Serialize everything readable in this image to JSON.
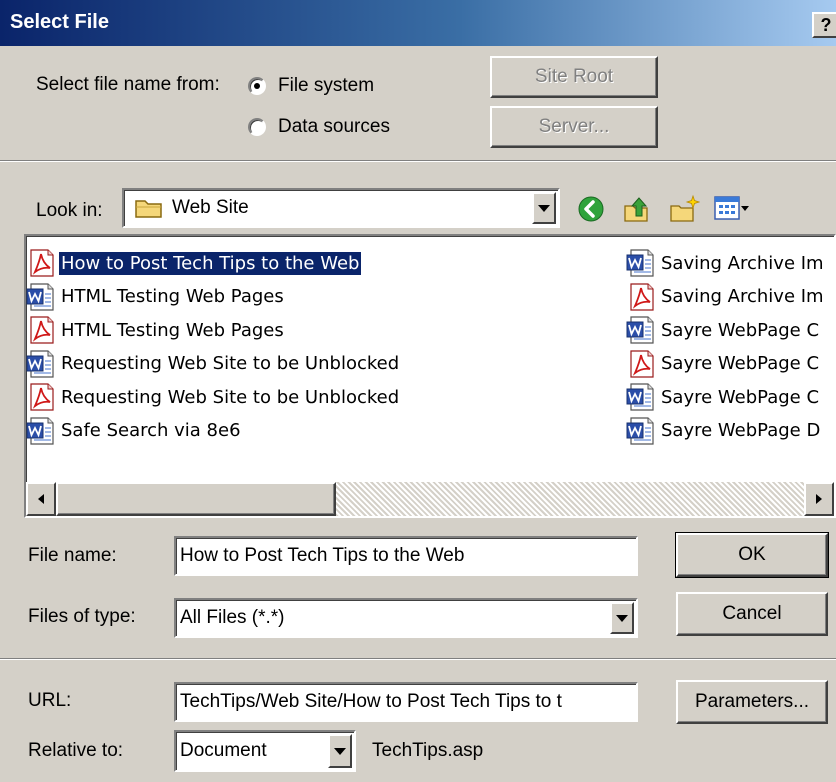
{
  "window": {
    "title": "Select File",
    "help_label": "?"
  },
  "source": {
    "label": "Select file name from:",
    "options": [
      {
        "label": "File system",
        "checked": true
      },
      {
        "label": "Data sources",
        "checked": false
      }
    ],
    "site_root_label": "Site Root",
    "server_label": "Server..."
  },
  "lookin": {
    "label": "Look in:",
    "value": "Web Site",
    "toolbar": [
      "back-icon",
      "up-folder-icon",
      "new-folder-icon",
      "view-menu-icon"
    ]
  },
  "files": [
    {
      "name": "How to Post Tech Tips to the Web",
      "type": "pdf",
      "selected": true
    },
    {
      "name": "HTML Testing Web Pages",
      "type": "word"
    },
    {
      "name": "HTML Testing Web Pages",
      "type": "pdf"
    },
    {
      "name": "Requesting Web Site to be Unblocked",
      "type": "word"
    },
    {
      "name": "Requesting Web Site to be Unblocked",
      "type": "pdf"
    },
    {
      "name": "Safe Search via 8e6",
      "type": "word"
    },
    {
      "name": "Saving Archive Im",
      "type": "word"
    },
    {
      "name": "Saving Archive Im",
      "type": "pdf"
    },
    {
      "name": "Sayre WebPage C",
      "type": "word"
    },
    {
      "name": "Sayre WebPage C",
      "type": "pdf"
    },
    {
      "name": "Sayre WebPage C",
      "type": "word"
    },
    {
      "name": "Sayre WebPage D",
      "type": "word"
    }
  ],
  "filename": {
    "label": "File name:",
    "value": "How to Post Tech Tips to the Web"
  },
  "filetype": {
    "label": "Files of type:",
    "value": "All Files (*.*)"
  },
  "buttons": {
    "ok": "OK",
    "cancel": "Cancel",
    "parameters": "Parameters..."
  },
  "url": {
    "label": "URL:",
    "value": "TechTips/Web Site/How to Post Tech Tips to t"
  },
  "relative": {
    "label": "Relative to:",
    "value": "Document",
    "page": "TechTips.asp"
  },
  "colors": {
    "title_start": "#0a246a",
    "title_end": "#a6caf0",
    "face": "#d4d0c8",
    "selection": "#0a246a"
  }
}
